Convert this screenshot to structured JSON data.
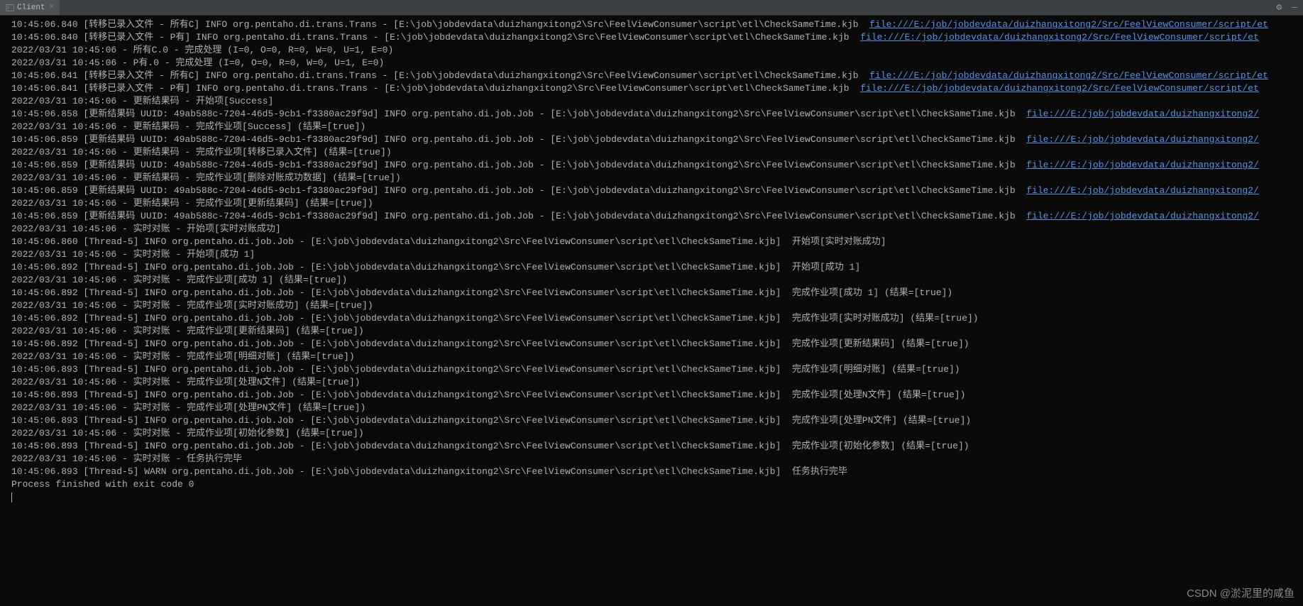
{
  "titlebar": {
    "tabTitle": "Client"
  },
  "lines": [
    {
      "prefix": "10:45:06.840 [转移已录入文件 - 所有C] INFO org.pentaho.di.trans.Trans - [E:\\job\\jobdevdata\\duizhangxitong2\\Src\\FeelViewConsumer\\script\\etl\\CheckSameTime.kjb  ",
      "link": "file:///E:/job/jobdevdata/duizhangxitong2/Src/FeelViewConsumer/script/et"
    },
    {
      "prefix": "10:45:06.840 [转移已录入文件 - P有] INFO org.pentaho.di.trans.Trans - [E:\\job\\jobdevdata\\duizhangxitong2\\Src\\FeelViewConsumer\\script\\etl\\CheckSameTime.kjb  ",
      "link": "file:///E:/job/jobdevdata/duizhangxitong2/Src/FeelViewConsumer/script/et"
    },
    {
      "prefix": "2022/03/31 10:45:06 - 所有C.0 - 完成处理 (I=0, O=0, R=0, W=0, U=1, E=0)"
    },
    {
      "prefix": "2022/03/31 10:45:06 - P有.0 - 完成处理 (I=0, O=0, R=0, W=0, U=1, E=0)"
    },
    {
      "prefix": "10:45:06.841 [转移已录入文件 - 所有C] INFO org.pentaho.di.trans.Trans - [E:\\job\\jobdevdata\\duizhangxitong2\\Src\\FeelViewConsumer\\script\\etl\\CheckSameTime.kjb  ",
      "link": "file:///E:/job/jobdevdata/duizhangxitong2/Src/FeelViewConsumer/script/et"
    },
    {
      "prefix": "10:45:06.841 [转移已录入文件 - P有] INFO org.pentaho.di.trans.Trans - [E:\\job\\jobdevdata\\duizhangxitong2\\Src\\FeelViewConsumer\\script\\etl\\CheckSameTime.kjb  ",
      "link": "file:///E:/job/jobdevdata/duizhangxitong2/Src/FeelViewConsumer/script/et"
    },
    {
      "prefix": "2022/03/31 10:45:06 - 更新结果码 - 开始项[Success]"
    },
    {
      "prefix": "10:45:06.858 [更新结果码 UUID: 49ab588c-7204-46d5-9cb1-f3380ac29f9d] INFO org.pentaho.di.job.Job - [E:\\job\\jobdevdata\\duizhangxitong2\\Src\\FeelViewConsumer\\script\\etl\\CheckSameTime.kjb  ",
      "link": "file:///E:/job/jobdevdata/duizhangxitong2/"
    },
    {
      "prefix": "2022/03/31 10:45:06 - 更新结果码 - 完成作业项[Success] (结果=[true])"
    },
    {
      "prefix": "10:45:06.859 [更新结果码 UUID: 49ab588c-7204-46d5-9cb1-f3380ac29f9d] INFO org.pentaho.di.job.Job - [E:\\job\\jobdevdata\\duizhangxitong2\\Src\\FeelViewConsumer\\script\\etl\\CheckSameTime.kjb  ",
      "link": "file:///E:/job/jobdevdata/duizhangxitong2/"
    },
    {
      "prefix": "2022/03/31 10:45:06 - 更新结果码 - 完成作业项[转移已录入文件] (结果=[true])"
    },
    {
      "prefix": "10:45:06.859 [更新结果码 UUID: 49ab588c-7204-46d5-9cb1-f3380ac29f9d] INFO org.pentaho.di.job.Job - [E:\\job\\jobdevdata\\duizhangxitong2\\Src\\FeelViewConsumer\\script\\etl\\CheckSameTime.kjb  ",
      "link": "file:///E:/job/jobdevdata/duizhangxitong2/"
    },
    {
      "prefix": "2022/03/31 10:45:06 - 更新结果码 - 完成作业项[删除对账成功数据] (结果=[true])"
    },
    {
      "prefix": "10:45:06.859 [更新结果码 UUID: 49ab588c-7204-46d5-9cb1-f3380ac29f9d] INFO org.pentaho.di.job.Job - [E:\\job\\jobdevdata\\duizhangxitong2\\Src\\FeelViewConsumer\\script\\etl\\CheckSameTime.kjb  ",
      "link": "file:///E:/job/jobdevdata/duizhangxitong2/"
    },
    {
      "prefix": "2022/03/31 10:45:06 - 更新结果码 - 完成作业项[更新结果码] (结果=[true])"
    },
    {
      "prefix": "10:45:06.859 [更新结果码 UUID: 49ab588c-7204-46d5-9cb1-f3380ac29f9d] INFO org.pentaho.di.job.Job - [E:\\job\\jobdevdata\\duizhangxitong2\\Src\\FeelViewConsumer\\script\\etl\\CheckSameTime.kjb  ",
      "link": "file:///E:/job/jobdevdata/duizhangxitong2/"
    },
    {
      "prefix": "2022/03/31 10:45:06 - 实时对账 - 开始项[实时对账成功]"
    },
    {
      "prefix": "10:45:06.860 [Thread-5] INFO org.pentaho.di.job.Job - [E:\\job\\jobdevdata\\duizhangxitong2\\Src\\FeelViewConsumer\\script\\etl\\CheckSameTime.kjb]  开始项[实时对账成功]"
    },
    {
      "prefix": "2022/03/31 10:45:06 - 实时对账 - 开始项[成功 1]"
    },
    {
      "prefix": "10:45:06.892 [Thread-5] INFO org.pentaho.di.job.Job - [E:\\job\\jobdevdata\\duizhangxitong2\\Src\\FeelViewConsumer\\script\\etl\\CheckSameTime.kjb]  开始项[成功 1]"
    },
    {
      "prefix": "2022/03/31 10:45:06 - 实时对账 - 完成作业项[成功 1] (结果=[true])"
    },
    {
      "prefix": "10:45:06.892 [Thread-5] INFO org.pentaho.di.job.Job - [E:\\job\\jobdevdata\\duizhangxitong2\\Src\\FeelViewConsumer\\script\\etl\\CheckSameTime.kjb]  完成作业项[成功 1] (结果=[true])"
    },
    {
      "prefix": "2022/03/31 10:45:06 - 实时对账 - 完成作业项[实时对账成功] (结果=[true])"
    },
    {
      "prefix": "10:45:06.892 [Thread-5] INFO org.pentaho.di.job.Job - [E:\\job\\jobdevdata\\duizhangxitong2\\Src\\FeelViewConsumer\\script\\etl\\CheckSameTime.kjb]  完成作业项[实时对账成功] (结果=[true])"
    },
    {
      "prefix": "2022/03/31 10:45:06 - 实时对账 - 完成作业项[更新结果码] (结果=[true])"
    },
    {
      "prefix": "10:45:06.892 [Thread-5] INFO org.pentaho.di.job.Job - [E:\\job\\jobdevdata\\duizhangxitong2\\Src\\FeelViewConsumer\\script\\etl\\CheckSameTime.kjb]  完成作业项[更新结果码] (结果=[true])"
    },
    {
      "prefix": "2022/03/31 10:45:06 - 实时对账 - 完成作业项[明细对账] (结果=[true])"
    },
    {
      "prefix": "10:45:06.893 [Thread-5] INFO org.pentaho.di.job.Job - [E:\\job\\jobdevdata\\duizhangxitong2\\Src\\FeelViewConsumer\\script\\etl\\CheckSameTime.kjb]  完成作业项[明细对账] (结果=[true])"
    },
    {
      "prefix": "2022/03/31 10:45:06 - 实时对账 - 完成作业项[处理N文件] (结果=[true])"
    },
    {
      "prefix": "10:45:06.893 [Thread-5] INFO org.pentaho.di.job.Job - [E:\\job\\jobdevdata\\duizhangxitong2\\Src\\FeelViewConsumer\\script\\etl\\CheckSameTime.kjb]  完成作业项[处理N文件] (结果=[true])"
    },
    {
      "prefix": "2022/03/31 10:45:06 - 实时对账 - 完成作业项[处理PN文件] (结果=[true])"
    },
    {
      "prefix": "10:45:06.893 [Thread-5] INFO org.pentaho.di.job.Job - [E:\\job\\jobdevdata\\duizhangxitong2\\Src\\FeelViewConsumer\\script\\etl\\CheckSameTime.kjb]  完成作业项[处理PN文件] (结果=[true])"
    },
    {
      "prefix": "2022/03/31 10:45:06 - 实时对账 - 完成作业项[初始化参数] (结果=[true])"
    },
    {
      "prefix": "10:45:06.893 [Thread-5] INFO org.pentaho.di.job.Job - [E:\\job\\jobdevdata\\duizhangxitong2\\Src\\FeelViewConsumer\\script\\etl\\CheckSameTime.kjb]  完成作业项[初始化参数] (结果=[true])"
    },
    {
      "prefix": "2022/03/31 10:45:06 - 实时对账 - 任务执行完毕"
    },
    {
      "prefix": "10:45:06.893 [Thread-5] WARN org.pentaho.di.job.Job - [E:\\job\\jobdevdata\\duizhangxitong2\\Src\\FeelViewConsumer\\script\\etl\\CheckSameTime.kjb]  任务执行完毕"
    },
    {
      "prefix": ""
    },
    {
      "prefix": "Process finished with exit code 0"
    }
  ],
  "watermark": "CSDN @淤泥里的咸鱼"
}
